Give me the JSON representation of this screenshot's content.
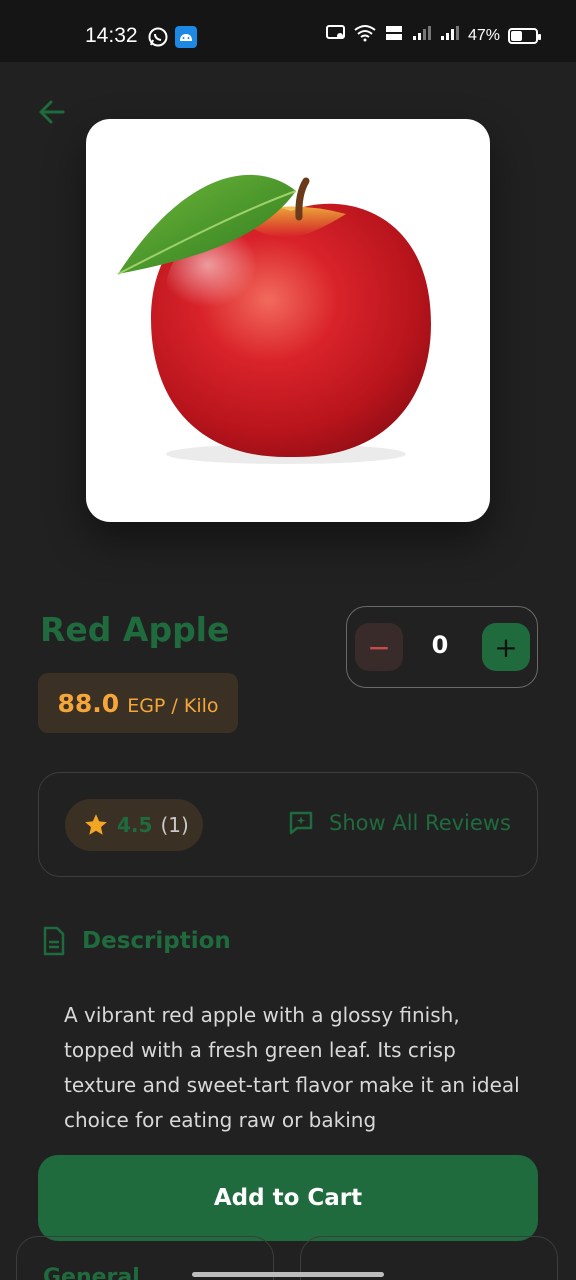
{
  "status_bar": {
    "time": "14:32",
    "battery": "47%",
    "battery_level": 0.47
  },
  "product": {
    "title": "Red Apple",
    "price": "88.0",
    "unit": "EGP / Kilo",
    "image_alt": "Red apple with green leaf"
  },
  "quantity": {
    "minus_label": "−",
    "value": "0",
    "plus_label": "+"
  },
  "reviews": {
    "rating": "4.5",
    "count": "(1)",
    "show_all_label": "Show All Reviews"
  },
  "description": {
    "title": "Description",
    "text": "A vibrant red apple with a glossy finish, topped with a fresh green leaf. Its crisp texture and sweet-tart flavor make it an ideal choice for eating raw or baking"
  },
  "actions": {
    "add_to_cart_label": "Add to Cart"
  },
  "tabs": {
    "general_label": "General"
  },
  "colors": {
    "background": "#212121",
    "accent_green": "#1f6b3d",
    "price_orange": "#f4a63a",
    "star_orange": "#f5a524",
    "minus_red": "#c94b4b"
  }
}
